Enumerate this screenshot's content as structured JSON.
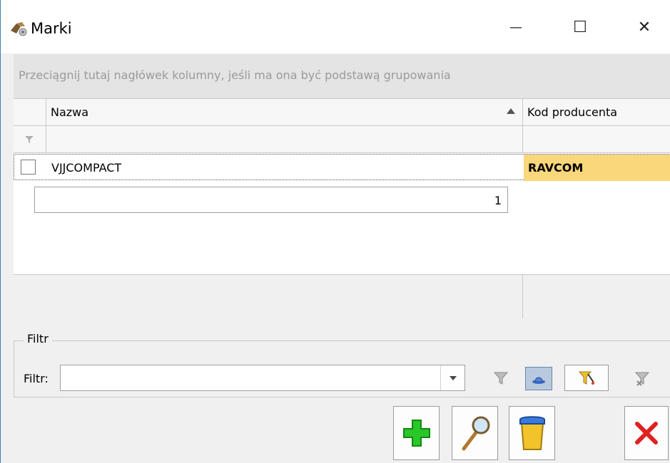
{
  "window": {
    "title": "Marki",
    "minimize_glyph": "—",
    "maximize_glyph": "☐",
    "close_glyph": "✕"
  },
  "grid": {
    "group_by_hint": "Przeciągnij tutaj nagłówek kolumny, jeśli ma ona być podstawą grupowania",
    "columns": [
      "Nazwa",
      "Kod producenta"
    ],
    "sort": {
      "column": "Nazwa",
      "direction": "ascending"
    },
    "rows": [
      {
        "nazwa": "VJJCOMPACT",
        "kod_producenta": "RAVCOM",
        "checked": false
      }
    ],
    "footer_count": "1"
  },
  "filter": {
    "group_title": "Filtr",
    "label": "Filtr:",
    "value": "",
    "tools": [
      "funnel-icon",
      "hat-icon",
      "funnel-star-icon",
      "funnel-clear-icon"
    ]
  },
  "actions": [
    "add-icon",
    "edit-icon",
    "delete-icon",
    "close-icon"
  ],
  "colors": {
    "selected_cell": "#fbd77c",
    "title_border": "#3c7fb1",
    "add_green": "#28c828",
    "close_red": "#e02020"
  }
}
